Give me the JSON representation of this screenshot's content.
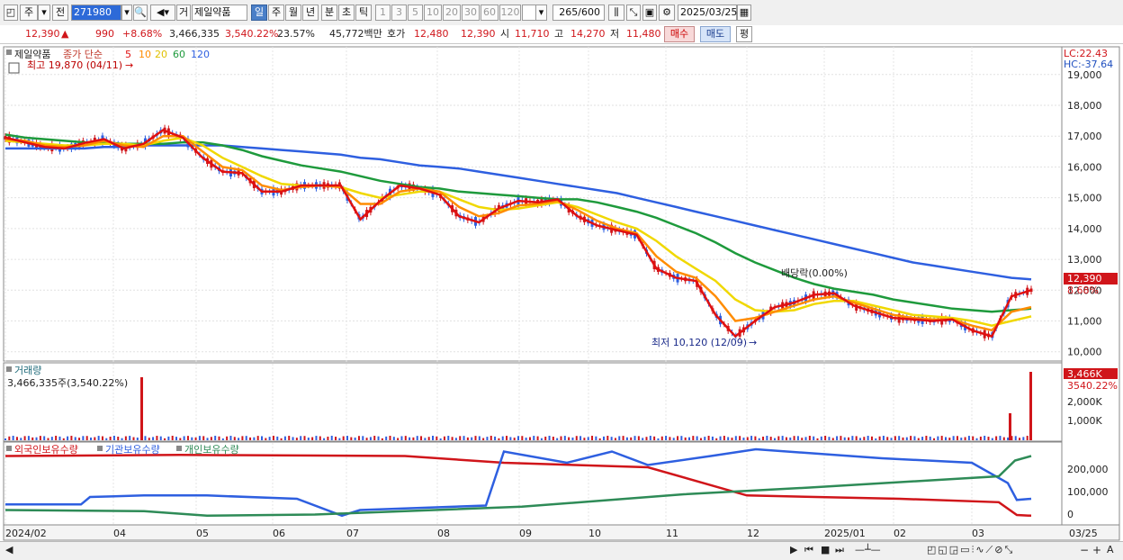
{
  "toolbar": {
    "code_type": "주",
    "prev_label": "전",
    "stock_code": "271980",
    "market_label": "거",
    "stock_name": "제일약품",
    "periods": [
      "일",
      "주",
      "월",
      "년",
      "분",
      "초",
      "틱"
    ],
    "active_period": "일",
    "intervals": [
      "1",
      "3",
      "5",
      "10",
      "20",
      "30",
      "60",
      "120"
    ],
    "count": "265",
    "count_max": "/600",
    "date": "2025/03/25"
  },
  "quote": {
    "price": "12,390",
    "arrow": "▲",
    "change": "990",
    "change_pct": "+8.68%",
    "volume": "3,466,335",
    "volume_ratio": "3,540.22%",
    "turnover": "23.57%",
    "amount": "45,772백만",
    "ask_label": "호가",
    "ask": "12,480",
    "bid": "12,390",
    "open_label": "시",
    "open": "11,710",
    "high_label": "고",
    "high": "14,270",
    "low_label": "저",
    "low": "11,480",
    "buy_label": "매수",
    "sell_label": "매도",
    "eval_label": "평"
  },
  "price_panel": {
    "name_label": "제일약품",
    "ma_label": "종가 단순",
    "ma_periods": [
      "5",
      "10",
      "20",
      "60",
      "120"
    ],
    "ma_colors": [
      "#e01010",
      "#ff8c00",
      "#f0d800",
      "#1e9a3c",
      "#2e5fe0"
    ],
    "high_note": "최고 19,870 (04/11)",
    "low_note": "최저 10,120 (12/09)",
    "dividend_note": "배당락(0.00%)",
    "lc": "LC:22.43",
    "hc": "HC:-37.64",
    "current_price": "12,390",
    "current_pct": "8.68%",
    "y_ticks": [
      "19,000",
      "18,000",
      "17,000",
      "16,000",
      "15,000",
      "14,000",
      "13,000",
      "12,000",
      "11,000",
      "10,000"
    ]
  },
  "volume_panel": {
    "title": "거래량",
    "value_note": "3,466,335주(3,540.22%)",
    "current": "3,466K",
    "current_pct": "3540.22%",
    "y_ticks": [
      "2,000K",
      "1,000K"
    ]
  },
  "holding_panel": {
    "legend": [
      "외국인보유수량",
      "기관보유수량",
      "개인보유수량"
    ],
    "colors": [
      "#d0151a",
      "#2e5fe0",
      "#2e8b57"
    ],
    "y_ticks": [
      "200,000",
      "100,000",
      "0"
    ]
  },
  "x_axis": {
    "labels": [
      "2024/02",
      "04",
      "05",
      "06",
      "07",
      "08",
      "09",
      "10",
      "11",
      "12",
      "2025/01",
      "02",
      "03",
      "03/25"
    ]
  },
  "chart_data": {
    "type": "line",
    "title": "",
    "ylim": [
      9700,
      19900
    ],
    "series": [
      {
        "name": "5",
        "values": [
          16950,
          16800,
          16650,
          16600,
          16780,
          16900,
          16600,
          16750,
          17200,
          16950,
          16300,
          15850,
          15800,
          15200,
          15200,
          15400,
          15400,
          15400,
          14300,
          14900,
          15400,
          15300,
          15100,
          14400,
          14200,
          14650,
          14900,
          14850,
          14950,
          14400,
          14100,
          13950,
          13800,
          12700,
          12400,
          12300,
          11200,
          10500,
          11000,
          11450,
          11600,
          11850,
          11900,
          11500,
          11300,
          11100,
          11050,
          11000,
          11050,
          10700,
          10500,
          11800,
          12000
        ]
      },
      {
        "name": "10",
        "values": [
          16900,
          16850,
          16700,
          16650,
          16700,
          16850,
          16700,
          16650,
          17000,
          17000,
          16500,
          16000,
          15900,
          15400,
          15250,
          15350,
          15400,
          15350,
          14800,
          14800,
          15200,
          15300,
          15200,
          14700,
          14400,
          14500,
          14750,
          14800,
          14900,
          14600,
          14250,
          14000,
          13850,
          13100,
          12600,
          12400,
          11800,
          11000,
          11100,
          11300,
          11500,
          11700,
          11800,
          11600,
          11400,
          11200,
          11100,
          11050,
          11050,
          10850,
          10700,
          11300,
          11450
        ]
      },
      {
        "name": "20",
        "values": [
          16850,
          16800,
          16750,
          16700,
          16700,
          16750,
          16750,
          16700,
          16850,
          16950,
          16700,
          16300,
          16000,
          15700,
          15450,
          15400,
          15400,
          15350,
          15150,
          15000,
          15100,
          15200,
          15200,
          14950,
          14700,
          14600,
          14650,
          14750,
          14850,
          14700,
          14450,
          14200,
          14000,
          13600,
          13100,
          12700,
          12300,
          11700,
          11350,
          11300,
          11350,
          11550,
          11650,
          11650,
          11500,
          11350,
          11200,
          11150,
          11100,
          11000,
          10850,
          11000,
          11150
        ]
      },
      {
        "name": "60",
        "values": [
          17050,
          16950,
          16900,
          16850,
          16800,
          16800,
          16750,
          16750,
          16750,
          16800,
          16800,
          16700,
          16550,
          16350,
          16200,
          16050,
          15950,
          15850,
          15700,
          15550,
          15450,
          15350,
          15300,
          15200,
          15150,
          15100,
          15050,
          15000,
          14950,
          14950,
          14850,
          14700,
          14550,
          14350,
          14100,
          13850,
          13550,
          13200,
          12900,
          12650,
          12400,
          12200,
          12050,
          11950,
          11850,
          11700,
          11600,
          11500,
          11400,
          11350,
          11300,
          11350,
          11400
        ]
      },
      {
        "name": "120",
        "values": [
          16600,
          16600,
          16600,
          16600,
          16600,
          16650,
          16650,
          16700,
          16700,
          16700,
          16700,
          16700,
          16650,
          16600,
          16550,
          16500,
          16450,
          16400,
          16300,
          16250,
          16150,
          16050,
          16000,
          15950,
          15850,
          15750,
          15650,
          15550,
          15450,
          15350,
          15250,
          15150,
          15000,
          14850,
          14700,
          14550,
          14400,
          14250,
          14100,
          13950,
          13800,
          13650,
          13500,
          13350,
          13200,
          13050,
          12900,
          12800,
          12700,
          12600,
          12500,
          12400,
          12350
        ]
      }
    ]
  }
}
